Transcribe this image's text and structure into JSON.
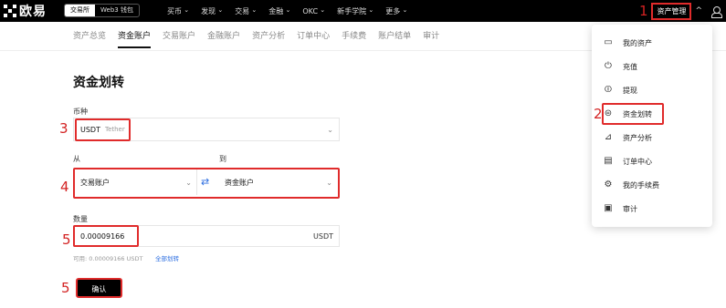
{
  "brand": {
    "name": "欧易"
  },
  "top_segment": [
    "交易所",
    "Web3 钱包"
  ],
  "top_nav": [
    "买币",
    "发现",
    "交易",
    "金融",
    "OKC",
    "新手学院",
    "更多"
  ],
  "asset_menu_label": "资产管理",
  "sub_tabs": [
    "资产总览",
    "资金账户",
    "交易账户",
    "金融账户",
    "资产分析",
    "订单中心",
    "手续费",
    "账户结单",
    "审计"
  ],
  "form": {
    "title": "资金划转",
    "currency_label": "币种",
    "currency_value": "USDT",
    "currency_name": "Tether",
    "from_label": "从",
    "to_label": "到",
    "from_account": "交易账户",
    "to_account": "资金账户",
    "swap_symbol": "⇄",
    "amount_label": "数量",
    "amount_value": "0.00009166",
    "amount_unit": "USDT",
    "available_text": "可用: 0.00009166 USDT",
    "transfer_all": "全部划转",
    "confirm_label": "确认"
  },
  "dropdown": [
    {
      "label": "我的资产",
      "icon": "wallet-icon"
    },
    {
      "label": "充值",
      "icon": "deposit-icon"
    },
    {
      "label": "提现",
      "icon": "withdraw-icon"
    },
    {
      "label": "资金划转",
      "icon": "transfer-icon"
    },
    {
      "label": "资产分析",
      "icon": "analysis-icon"
    },
    {
      "label": "订单中心",
      "icon": "order-icon"
    },
    {
      "label": "我的手续费",
      "icon": "fee-icon"
    },
    {
      "label": "审计",
      "icon": "audit-icon"
    }
  ],
  "annotations": {
    "n1": "1",
    "n2": "2",
    "n3": "3",
    "n4": "4",
    "n5a": "5",
    "n5b": "5"
  },
  "colors": {
    "accent_red": "#e02b2b",
    "link_blue": "#2b6de0",
    "topbar": "#000000"
  }
}
